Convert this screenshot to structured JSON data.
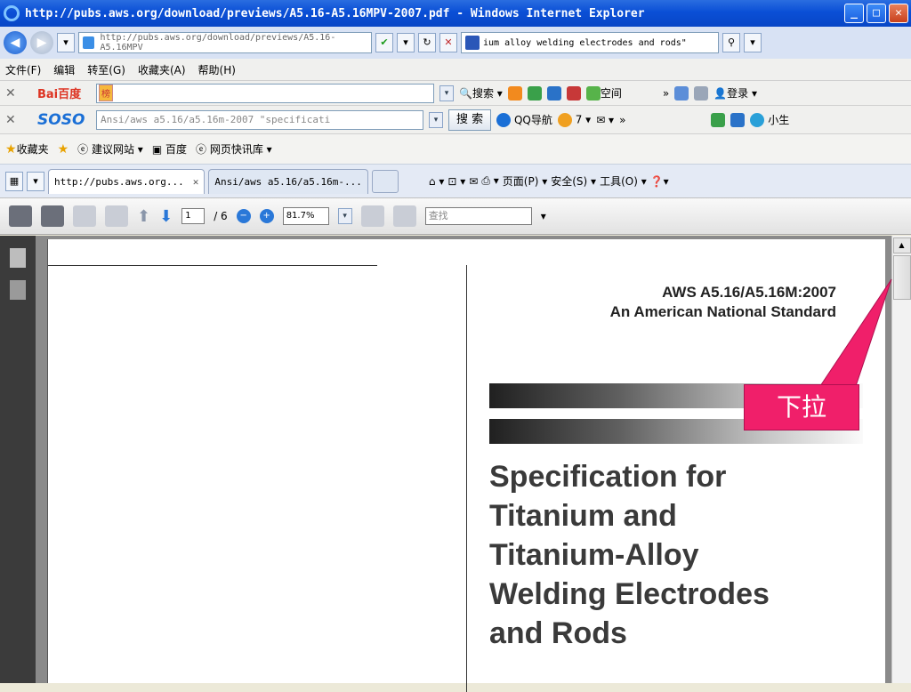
{
  "window": {
    "title": "http://pubs.aws.org/download/previews/A5.16-A5.16MPV-2007.pdf - Windows Internet Explorer",
    "min": "_",
    "max": "□",
    "close": "✕"
  },
  "address": {
    "url": "http://pubs.aws.org/download/previews/A5.16-A5.16MPV",
    "search_text": "ium alloy welding electrodes and rods\"",
    "back_icon": "back-arrow-icon",
    "forward_icon": "forward-arrow-icon"
  },
  "menu": [
    "文件(F)",
    "编辑",
    "转至(G)",
    "收藏夹(A)",
    "帮助(H)"
  ],
  "baidu": {
    "logo": "Bai百度",
    "tag": "榜",
    "search_label": "搜索",
    "space_label": "空间",
    "more": "»",
    "login": "登录"
  },
  "soso": {
    "logo": "SOSO",
    "query": "Ansi/aws a5.16/a5.16m-2007 \"specificati",
    "search_btn": "搜 索",
    "qq_nav": "QQ导航",
    "count": "7",
    "more": "»",
    "user": "小生"
  },
  "favorites": {
    "label": "收藏夹",
    "items": [
      "建议网站",
      "百度",
      "网页快讯库"
    ]
  },
  "tabs": {
    "items": [
      "http://pubs.aws.org...",
      "Ansi/aws a5.16/a5.16m-..."
    ],
    "close": "✕",
    "right": [
      "页面(P)",
      "安全(S)",
      "工具(O)"
    ]
  },
  "pdf": {
    "page": "1",
    "total": "/ 6",
    "zoom": "81.7%",
    "find_placeholder": "查找"
  },
  "document": {
    "code": "AWS A5.16/A5.16M:2007",
    "subtitle": "An American National Standard",
    "title_lines": [
      "Specification for",
      "Titanium and",
      "Titanium-Alloy",
      "Welding Electrodes",
      "and Rods"
    ]
  },
  "annotation": {
    "label": "下拉",
    "color": "#f01f6a"
  }
}
